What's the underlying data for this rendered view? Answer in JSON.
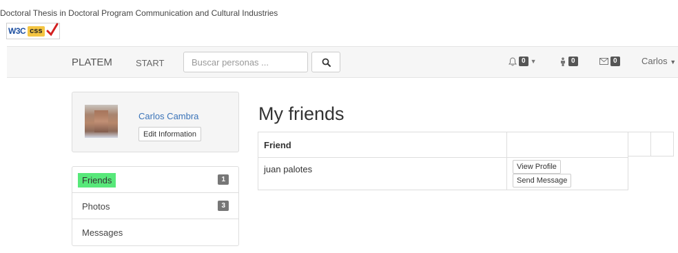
{
  "header": {
    "thesis_title": "Doctoral Thesis in Doctoral Program Communication and Cultural Industries",
    "badge_w3c": "W3C",
    "badge_css": "css"
  },
  "navbar": {
    "brand": "PLATEM",
    "start_label": "START",
    "search_placeholder": "Buscar personas ...",
    "notifications_count": "0",
    "friend_requests_count": "0",
    "messages_count": "0",
    "user_name": "Carlos"
  },
  "profile": {
    "name": "Carlos Cambra",
    "edit_label": "Edit Information"
  },
  "menu": {
    "items": [
      {
        "label": "Friends",
        "count": "1"
      },
      {
        "label": "Photos",
        "count": "3"
      },
      {
        "label": "Messages",
        "count": ""
      }
    ]
  },
  "main": {
    "title": "My friends",
    "table": {
      "header_friend": "Friend",
      "rows": [
        {
          "name": "juan palotes",
          "view_label": "View Profile",
          "send_label": "Send Message"
        }
      ]
    }
  },
  "colors": {
    "active_highlight": "#58e87a",
    "link_blue": "#3a73b8",
    "navbar_bg": "#f6f6f6"
  }
}
